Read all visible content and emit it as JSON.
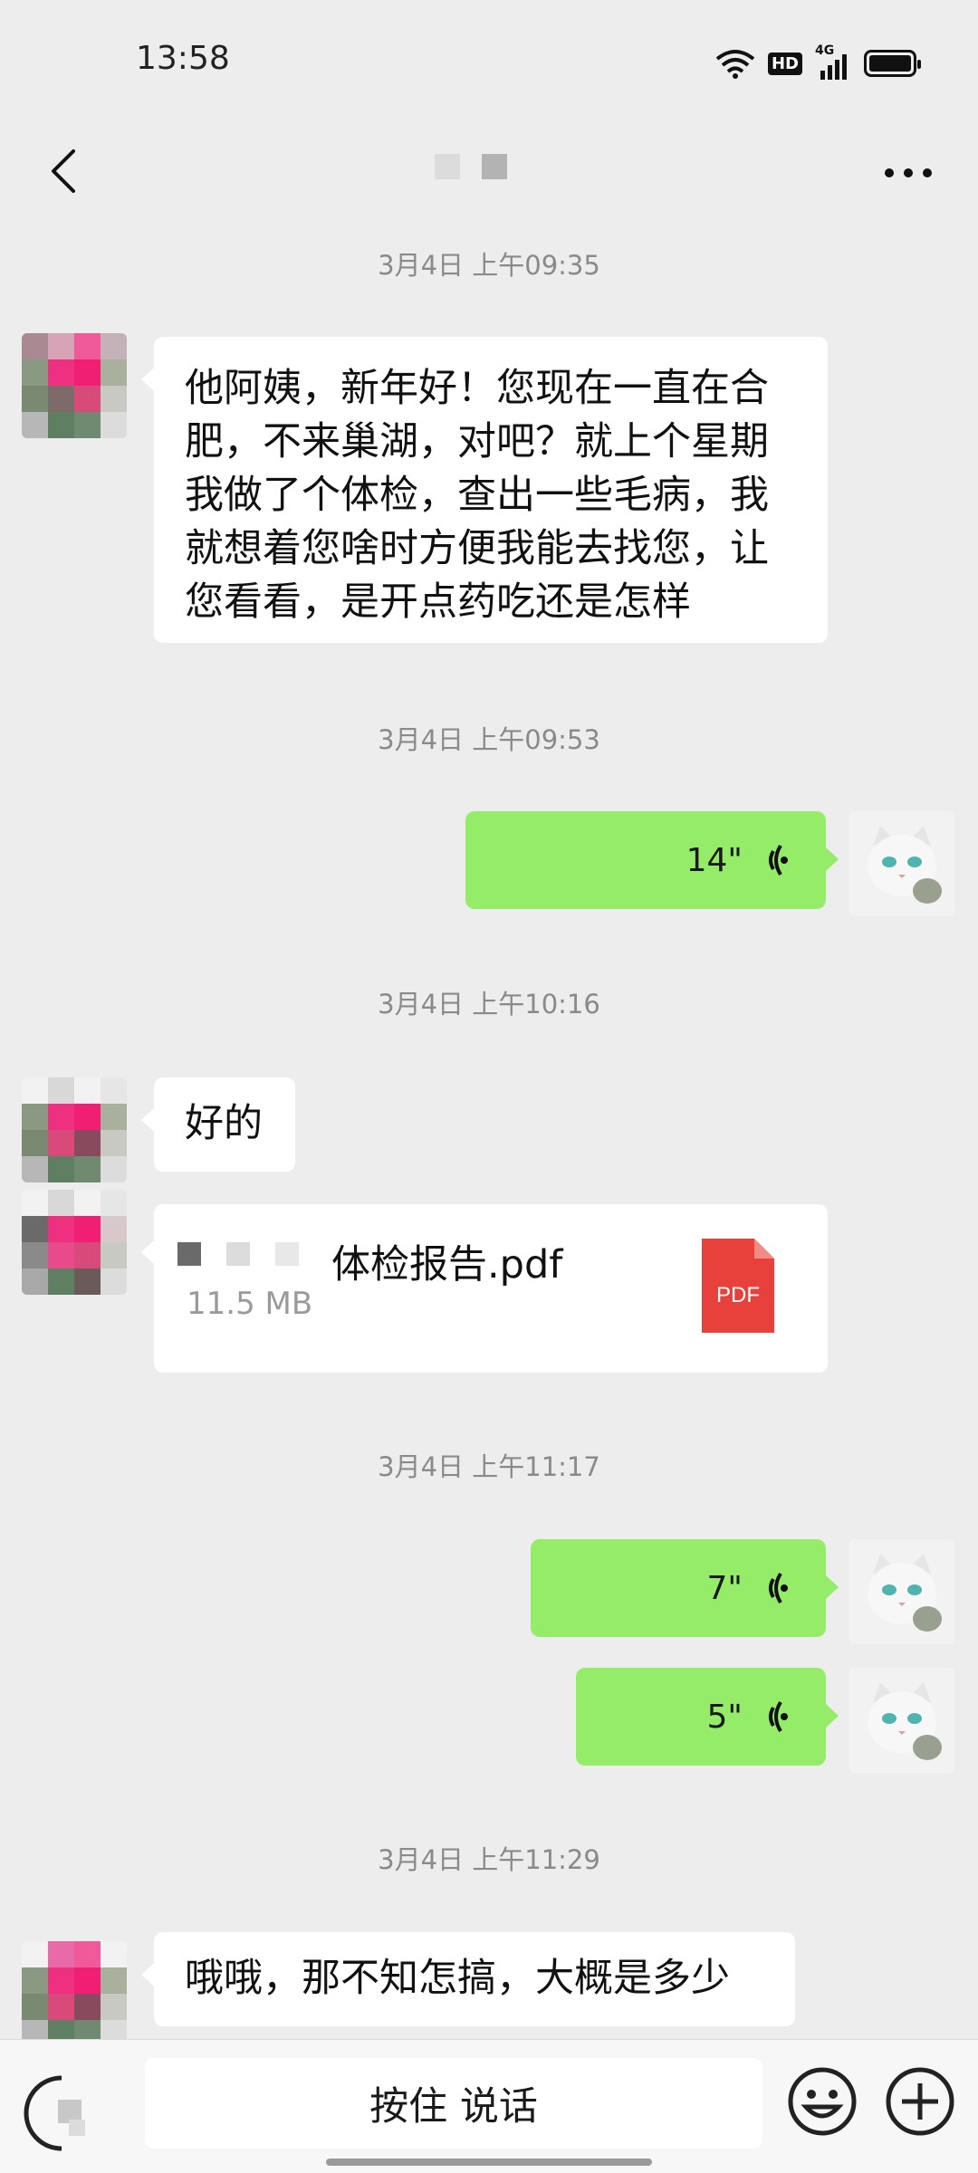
{
  "status": {
    "time": "13:58",
    "hd": "HD",
    "network": "4G"
  },
  "nav": {
    "title_hidden": "",
    "more": "..."
  },
  "messages": {
    "t1": "3月4日 上午09:35",
    "m1_lines": [
      "他阿姨，新年好！您现在一直在合",
      "肥，不来巢湖，对吧？就上个星期",
      "我做了个体检，查出一些毛病，我",
      "就想着您啥时方便我能去找您，让",
      "您看看，是开点药吃还是怎样"
    ],
    "t2": "3月4日 上午09:53",
    "v1": "14\"",
    "t3": "3月4日 上午10:16",
    "m2": "好的",
    "file_name": "体检报告.pdf",
    "file_size": "11.5 MB",
    "file_icon_label": "PDF",
    "t4": "3月4日 上午11:17",
    "v2": "7\"",
    "v3": "5\"",
    "t5": "3月4日 上午11:29",
    "m3": "哦哦，那不知怎搞，大概是多少"
  },
  "bottom": {
    "hold_to_talk": "按住 说话"
  },
  "colors": {
    "accent_green": "#95ec69",
    "pdf_red": "#e8403b"
  }
}
